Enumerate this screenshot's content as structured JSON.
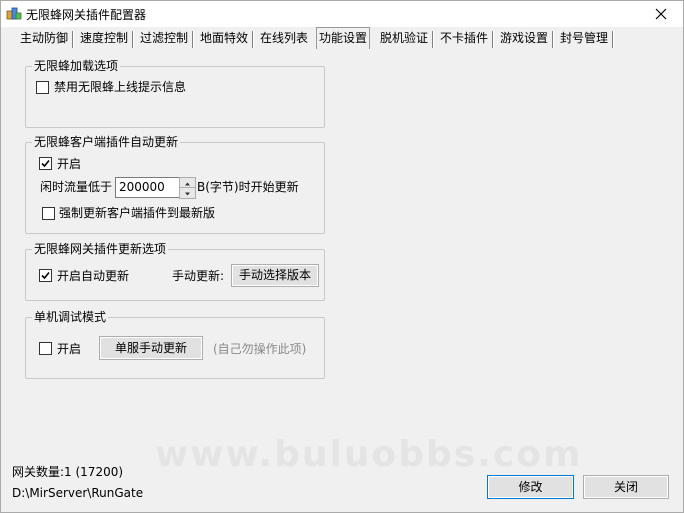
{
  "window": {
    "title": "无限蜂网关插件配置器"
  },
  "tabs": [
    {
      "label": "主动防御"
    },
    {
      "label": "速度控制"
    },
    {
      "label": "过滤控制"
    },
    {
      "label": "地面特效"
    },
    {
      "label": "在线列表"
    },
    {
      "label": "功能设置",
      "active": true
    },
    {
      "label": "脱机验证"
    },
    {
      "label": "不卡插件"
    },
    {
      "label": "游戏设置"
    },
    {
      "label": "封号管理"
    }
  ],
  "groups": {
    "load": {
      "title": "无限蜂加载选项",
      "disable_online_msg": {
        "label": "禁用无限蜂上线提示信息",
        "checked": false
      }
    },
    "client_update": {
      "title": "无限蜂客户端插件自动更新",
      "enable": {
        "label": "开启",
        "checked": true
      },
      "traffic_prefix": "闲时流量低于",
      "traffic_value": "200000",
      "traffic_suffix": "B(字节)时开始更新",
      "force": {
        "label": "强制更新客户端插件到最新版",
        "checked": false
      }
    },
    "gateway_update": {
      "title": "无限蜂网关插件更新选项",
      "auto": {
        "label": "开启自动更新",
        "checked": true
      },
      "manual_label": "手动更新:",
      "manual_button": "手动选择版本"
    },
    "debug": {
      "title": "单机调试模式",
      "enable": {
        "label": "开启",
        "checked": false
      },
      "button": "单服手动更新",
      "hint": "(自己勿操作此项)"
    }
  },
  "footer": {
    "gateway_count": "网关数量:1 (17200)",
    "path": "D:\\MirServer\\RunGate",
    "modify_button": "修改",
    "close_button": "关闭"
  },
  "watermark": "www.buluobbs.com"
}
